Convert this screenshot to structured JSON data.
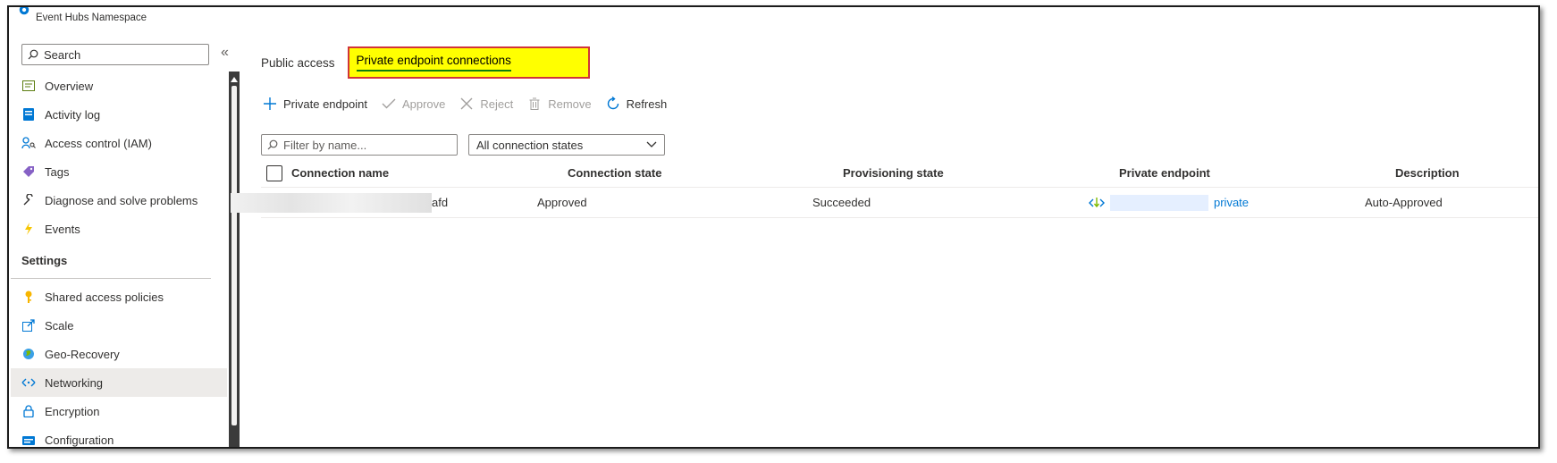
{
  "header": {
    "namespace_type": "Event Hubs Namespace"
  },
  "sidebar": {
    "search_placeholder": "Search",
    "collapse_glyph": "«",
    "items": [
      {
        "label": "Overview",
        "icon": "overview-icon"
      },
      {
        "label": "Activity log",
        "icon": "activity-log-icon"
      },
      {
        "label": "Access control (IAM)",
        "icon": "iam-icon"
      },
      {
        "label": "Tags",
        "icon": "tag-icon"
      },
      {
        "label": "Diagnose and solve problems",
        "icon": "wrench-icon"
      },
      {
        "label": "Events",
        "icon": "lightning-icon"
      }
    ],
    "settings_heading": "Settings",
    "settings_items": [
      {
        "label": "Shared access policies",
        "icon": "key-icon"
      },
      {
        "label": "Scale",
        "icon": "scale-icon"
      },
      {
        "label": "Geo-Recovery",
        "icon": "globe-icon"
      },
      {
        "label": "Networking",
        "icon": "networking-icon",
        "active": true
      },
      {
        "label": "Encryption",
        "icon": "lock-icon"
      },
      {
        "label": "Configuration",
        "icon": "configuration-icon"
      }
    ]
  },
  "main": {
    "tabs": {
      "public": "Public access",
      "private": "Private endpoint connections"
    },
    "toolbar": {
      "add": "Private endpoint",
      "approve": "Approve",
      "reject": "Reject",
      "remove": "Remove",
      "refresh": "Refresh"
    },
    "filter_placeholder": "Filter by name...",
    "state_filter": "All connection states",
    "table": {
      "headers": [
        "Connection name",
        "Connection state",
        "Provisioning state",
        "Private endpoint",
        "Description"
      ],
      "rows": [
        {
          "name_suffix": "afd",
          "state": "Approved",
          "provisioning": "Succeeded",
          "endpoint_suffix": "private",
          "description": "Auto-Approved"
        }
      ]
    }
  },
  "colors": {
    "highlight": "#ffff00",
    "highlight_border": "#d13438",
    "selected_underline": "#107c10",
    "link": "#0078d4"
  }
}
